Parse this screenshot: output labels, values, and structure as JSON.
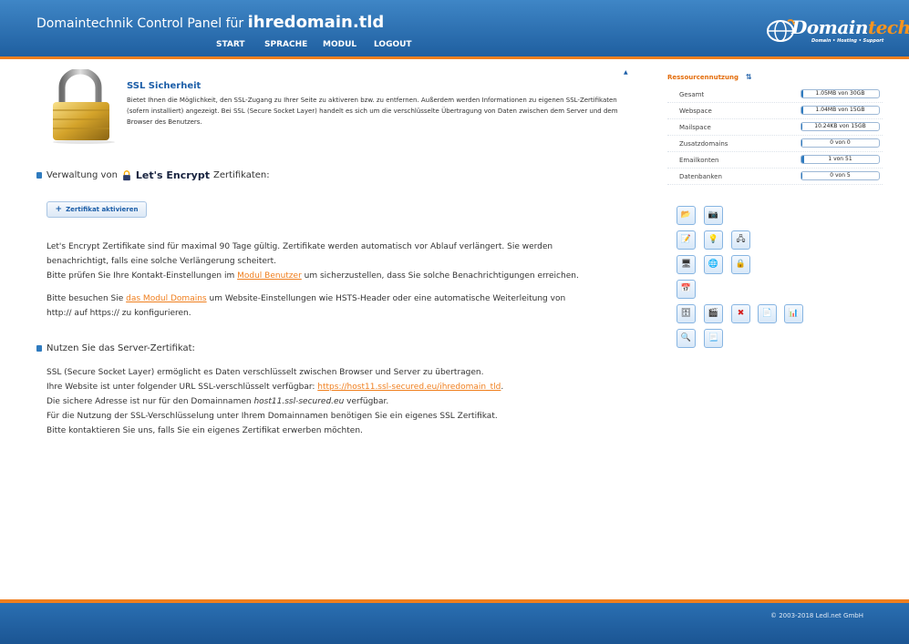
{
  "header": {
    "title_prefix": "Domaintechnik Control Panel für",
    "domain": "ihredomain.tld",
    "nav": [
      {
        "label": "START"
      },
      {
        "label": "SPRACHE"
      },
      {
        "label": "MODUL"
      },
      {
        "label": "LOGOUT"
      }
    ],
    "logo_main": "Domain",
    "logo_accent": "technik",
    "logo_tagline": "Domain • Hosting • Support"
  },
  "ssl": {
    "title": "SSL Sicherheit",
    "description": "Bietet Ihnen die Möglichkeit, den SSL-Zugang zu Ihrer Seite zu aktiveren bzw. zu entfernen. Außerdem werden Informationen zu eigenen SSL-Zertifikaten (sofern installiert) angezeigt. Bei SSL (Secure Socket Layer) handelt es sich um die verschlüsselte Übertragung von Daten zwischen dem Server und dem Browser des Benutzers."
  },
  "letsencrypt": {
    "heading_before": "Verwaltung von",
    "logo_text": "Let's Encrypt",
    "heading_after": "Zertifikaten:",
    "activate_button": "Zertifikat aktivieren",
    "p1_line1": "Let's Encrypt Zertifikate sind für maximal 90 Tage gültig. Zertifikate werden automatisch vor Ablauf verlängert. Sie werden",
    "p1_line2": "benachrichtigt, falls eine solche Verlängerung scheitert.",
    "p1_line3_before": "Bitte prüfen Sie Ihre Kontakt-Einstellungen im",
    "p1_link": "Modul Benutzer",
    "p1_line3_after": "um sicherzustellen, dass Sie solche Benachrichtigungen erreichen.",
    "p2_before": "Bitte besuchen Sie",
    "p2_link": "das Modul Domains",
    "p2_after": "um Website-Einstellungen wie HSTS-Header oder eine automatische Weiterleitung von",
    "p2_line2": "http:// auf https:// zu konfigurieren."
  },
  "server_cert": {
    "heading": "Nutzen Sie das Server-Zertifikat:",
    "line1": "SSL (Secure Socket Layer) ermöglicht es Daten verschlüsselt zwischen Browser und Server zu übertragen.",
    "line2_before": "Ihre Website ist unter folgender URL SSL-verschlüsselt verfügbar:",
    "line2_link": "https://host11.ssl-secured.eu/ihredomain_tld",
    "line2_after": ".",
    "line3_before": "Die sichere Adresse ist nur für den Domainnamen",
    "line3_host": "host11.ssl-secured.eu",
    "line3_after": "verfügbar.",
    "line4": "Für die Nutzung der SSL-Verschlüsselung unter Ihrem Domainnamen benötigen Sie ein eigenes SSL Zertifikat.",
    "line5": "Bitte kontaktieren Sie uns, falls Sie ein eigenes Zertifikat erwerben möchten."
  },
  "resources": {
    "title": "Ressourcennutzung",
    "rows": [
      {
        "label": "Gesamt",
        "value": "1.05MB von 30GB",
        "fill": 0.01
      },
      {
        "label": "Webspace",
        "value": "1.04MB von 15GB",
        "fill": 0.01
      },
      {
        "label": "Mailspace",
        "value": "10.24KB von 15GB",
        "fill": 0.0
      },
      {
        "label": "Zusatzdomains",
        "value": "0 von 0",
        "fill": 0.0
      },
      {
        "label": "Emailkonten",
        "value": "1 von 51",
        "fill": 0.03
      },
      {
        "label": "Datenbanken",
        "value": "0 von 5",
        "fill": 0.0
      }
    ]
  },
  "modules": [
    {
      "icon": "folder-icon",
      "glyph": "📂"
    },
    {
      "icon": "webcam-icon",
      "glyph": "📷"
    },
    {
      "icon": "document-edit-icon",
      "glyph": "📝"
    },
    {
      "icon": "lightbulb-icon",
      "glyph": "💡"
    },
    {
      "icon": "network-icon",
      "glyph": "🖧"
    },
    {
      "icon": "monitor-icon",
      "glyph": "🖥"
    },
    {
      "icon": "globe-icon",
      "glyph": "🌐"
    },
    {
      "icon": "ssl-lock-icon",
      "glyph": "🔒"
    },
    {
      "icon": "calendar-icon",
      "glyph": "📅"
    },
    {
      "icon": "database-icon",
      "glyph": "🗄"
    },
    {
      "icon": "clapperboard-icon",
      "glyph": "🎬"
    },
    {
      "icon": "delete-icon",
      "glyph": "✖"
    },
    {
      "icon": "notepad-icon",
      "glyph": "📄"
    },
    {
      "icon": "statistics-icon",
      "glyph": "📊"
    },
    {
      "icon": "search-users-icon",
      "glyph": "🔍"
    },
    {
      "icon": "pages-icon",
      "glyph": "📃"
    }
  ],
  "footer": {
    "copyright": "© 2003-2018 Ledl.net GmbH"
  }
}
